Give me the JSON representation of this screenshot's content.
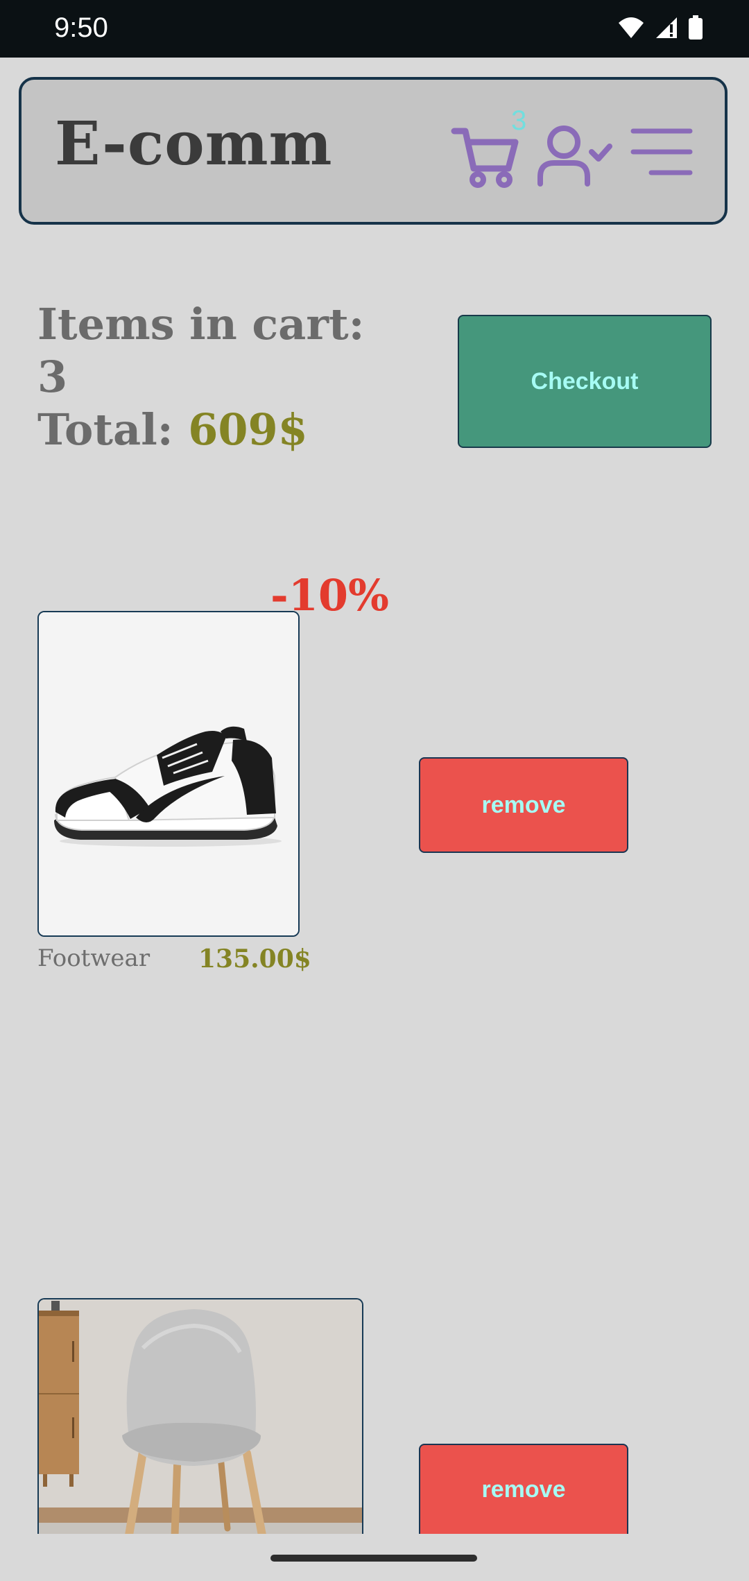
{
  "status_bar": {
    "time": "9:50",
    "icons": [
      "wifi-icon",
      "signal-icon",
      "battery-icon"
    ]
  },
  "header": {
    "title": "E-comm",
    "cart_count": "3",
    "icons": [
      "cart-icon",
      "user-check-icon",
      "menu-icon"
    ]
  },
  "summary": {
    "items_label": "Items in cart:",
    "items_count": "3",
    "total_label": "Total:",
    "total_value": "609$"
  },
  "checkout": {
    "label": "Checkout"
  },
  "cart_items": [
    {
      "discount": "-10%",
      "category": "Footwear",
      "price": "135.00$",
      "remove_label": "remove",
      "image": "sneaker-image"
    },
    {
      "remove_label": "remove",
      "image": "chair-image"
    }
  ],
  "colors": {
    "background": "#d9d9d9",
    "header_bg": "#c4c4c4",
    "header_border": "#163349",
    "icon_purple": "#8a6bb8",
    "badge_cyan": "#72dede",
    "price_olive": "#848424",
    "discount_red": "#e33b2e",
    "checkout_green": "#45977c",
    "remove_red": "#eb524d",
    "button_text": "#a6fbf4"
  }
}
